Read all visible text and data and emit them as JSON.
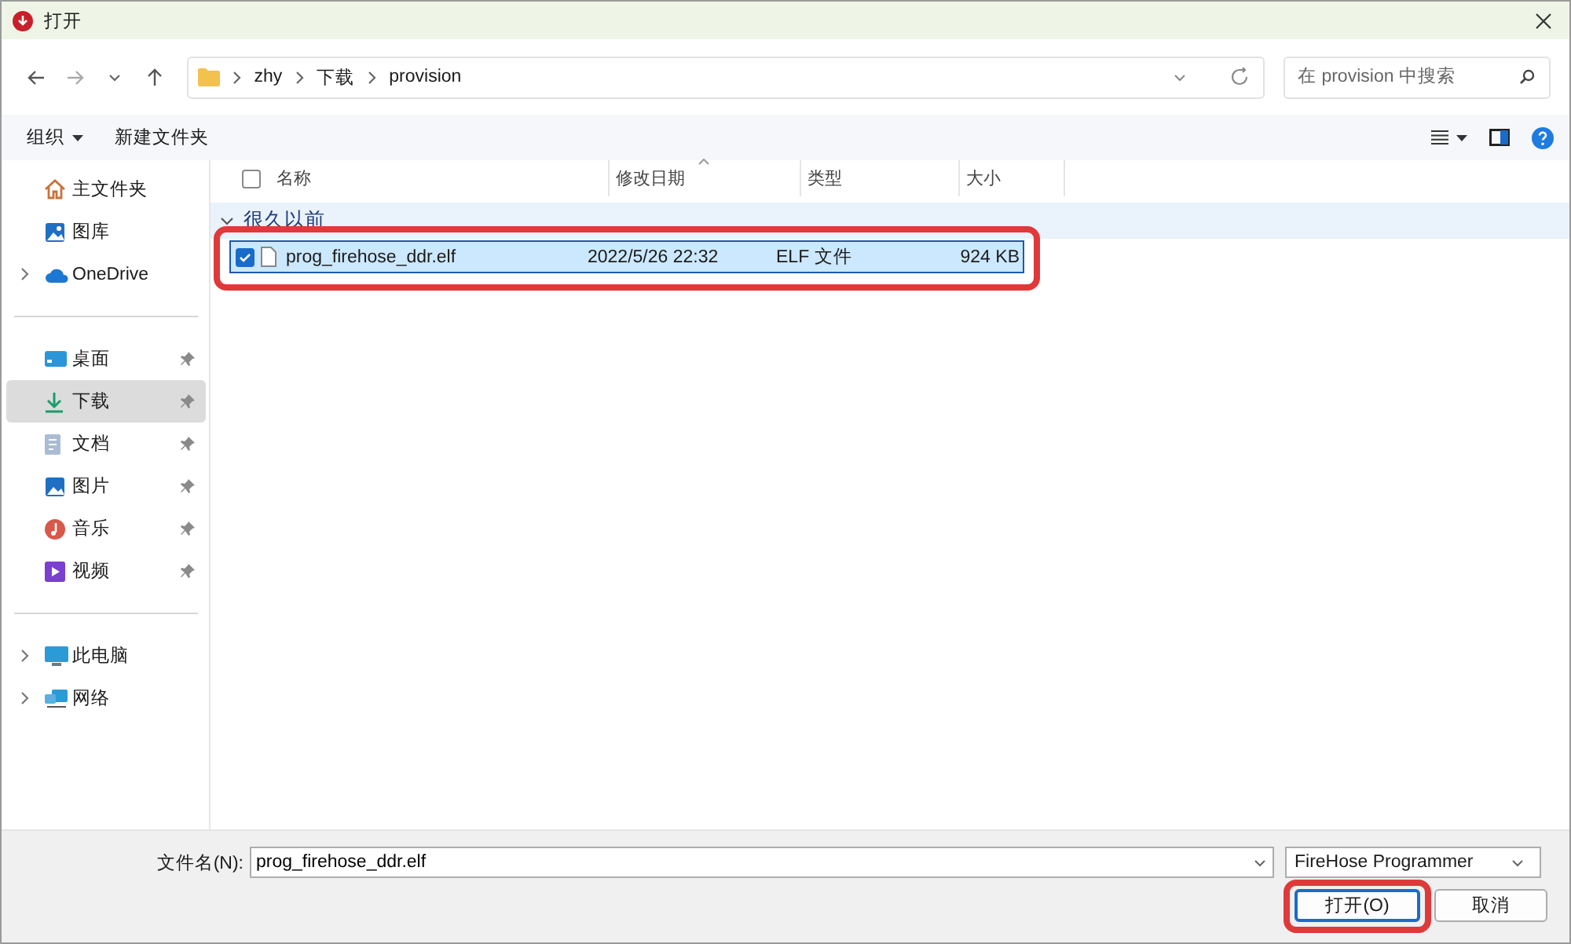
{
  "window": {
    "title": "打开"
  },
  "navigation": {
    "path": [
      "zhy",
      "下载",
      "provision"
    ],
    "search": {
      "placeholder": "在 provision 中搜索"
    }
  },
  "toolbar": {
    "organize": "组织",
    "new_folder": "新建文件夹"
  },
  "sidebar": {
    "groups": [
      [
        {
          "label": "主文件夹",
          "kind": "home",
          "pinned": false,
          "expandable": false,
          "selected": false
        },
        {
          "label": "图库",
          "kind": "gallery",
          "pinned": false,
          "expandable": false,
          "selected": false
        },
        {
          "label": "OneDrive",
          "kind": "cloud",
          "pinned": false,
          "expandable": true,
          "selected": false
        }
      ],
      [
        {
          "label": "桌面",
          "kind": "desktop",
          "pinned": true,
          "expandable": false,
          "selected": false
        },
        {
          "label": "下载",
          "kind": "download",
          "pinned": true,
          "expandable": false,
          "selected": true
        },
        {
          "label": "文档",
          "kind": "documents",
          "pinned": true,
          "expandable": false,
          "selected": false
        },
        {
          "label": "图片",
          "kind": "pictures",
          "pinned": true,
          "expandable": false,
          "selected": false
        },
        {
          "label": "音乐",
          "kind": "music",
          "pinned": true,
          "expandable": false,
          "selected": false
        },
        {
          "label": "视频",
          "kind": "videos",
          "pinned": true,
          "expandable": false,
          "selected": false
        }
      ],
      [
        {
          "label": "此电脑",
          "kind": "pc",
          "pinned": false,
          "expandable": true,
          "selected": false
        },
        {
          "label": "网络",
          "kind": "network",
          "pinned": false,
          "expandable": true,
          "selected": false
        }
      ]
    ]
  },
  "file_list": {
    "header_checked": false,
    "columns": [
      {
        "label": "名称",
        "sorted": false
      },
      {
        "label": "修改日期",
        "sorted": true
      },
      {
        "label": "类型",
        "sorted": false
      },
      {
        "label": "大小",
        "sorted": false
      }
    ],
    "groups": [
      {
        "label": "很久以前",
        "expanded": true,
        "files": [
          {
            "name": "prog_firehose_ddr.elf",
            "modified": "2022/5/26 22:32",
            "type": "ELF 文件",
            "size": "924 KB",
            "selected": true,
            "checked": true,
            "highlighted": true
          }
        ]
      }
    ]
  },
  "footer": {
    "filename_label": "文件名(N):",
    "filename": "prog_firehose_ddr.elf",
    "file_type": "FireHose Programmer",
    "buttons": [
      {
        "label": "打开(O)",
        "kind": "primary",
        "highlighted": true
      },
      {
        "label": "取消",
        "kind": "secondary",
        "highlighted": false
      }
    ]
  }
}
